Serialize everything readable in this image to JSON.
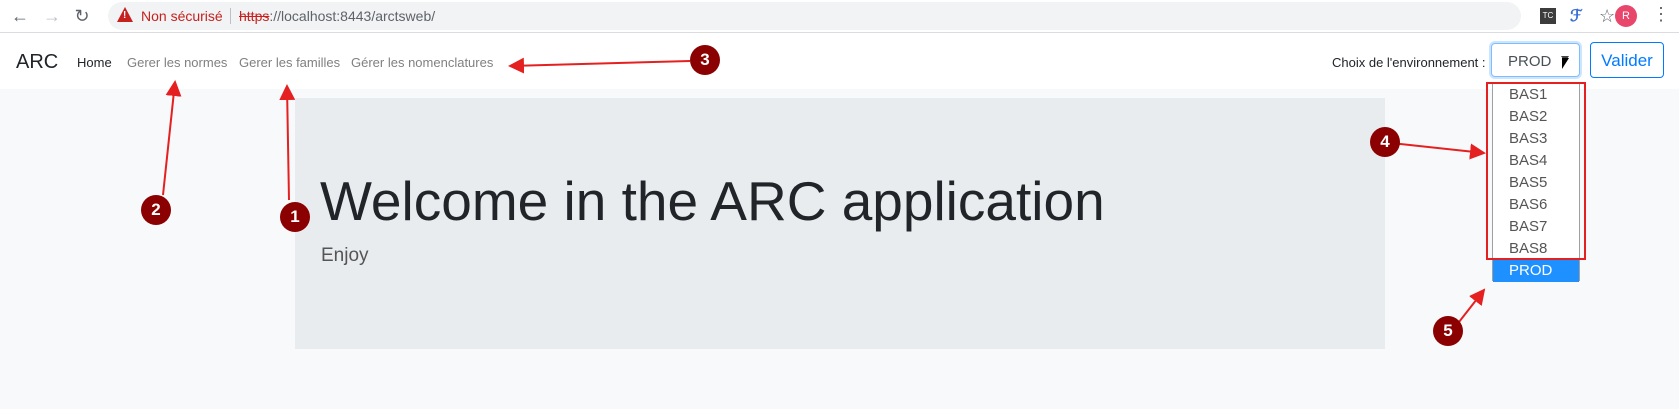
{
  "browser": {
    "security_text": "Non sécurisé",
    "url_scheme": "https",
    "url_rest": "://localhost:8443/arctsweb/",
    "ext1_label": "TC",
    "profile_initial": "R"
  },
  "navbar": {
    "brand": "ARC",
    "links": [
      {
        "label": "Home"
      },
      {
        "label": "Gerer les normes"
      },
      {
        "label": "Gerer les familles"
      },
      {
        "label": "Gérer les nomenclatures"
      }
    ],
    "env_label": "Choix de l'environnement :",
    "env_selected": "PROD",
    "submit_label": "Valider"
  },
  "jumbotron": {
    "title": "Welcome in the ARC application",
    "subtitle": "Enjoy"
  },
  "dropdown": {
    "options": [
      "BAS1",
      "BAS2",
      "BAS3",
      "BAS4",
      "BAS5",
      "BAS6",
      "BAS7",
      "BAS8",
      "PROD"
    ],
    "selected": "PROD"
  },
  "annotations": [
    "1",
    "2",
    "3",
    "4",
    "5"
  ],
  "colors": {
    "annotation": "#8b0000",
    "arrow": "#e52020",
    "highlight": "#1e90ff",
    "primary": "#007bff"
  }
}
